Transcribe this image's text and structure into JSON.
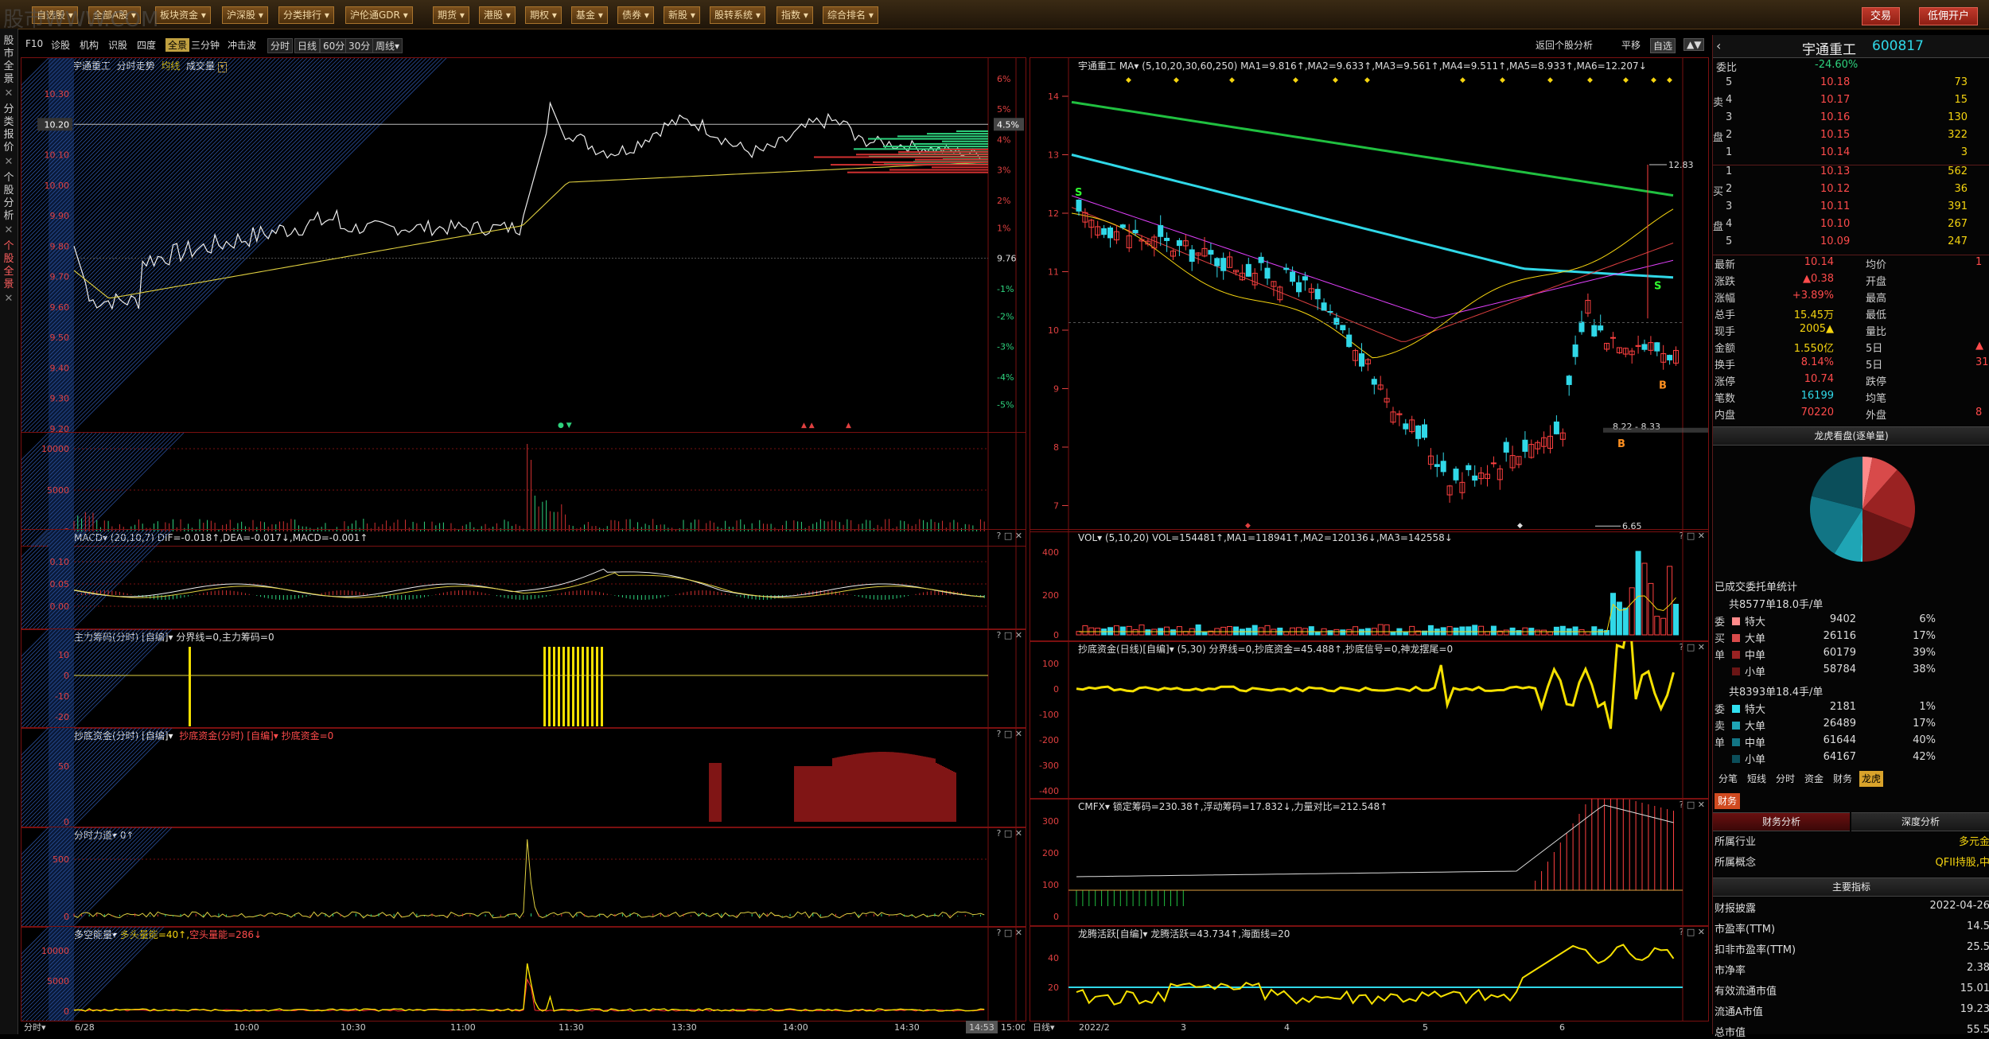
{
  "app": {
    "watermark": "股市WWW.COM"
  },
  "menu": {
    "items": [
      "自选股",
      "全部A股",
      "板块资金",
      "沪深股",
      "分类排行",
      "沪伦通GDR",
      "期货",
      "港股",
      "期权",
      "基金",
      "债券",
      "新股",
      "股转系统",
      "指数",
      "综合排名"
    ],
    "right": [
      "交易",
      "低佣开户"
    ]
  },
  "side_tabs": [
    "股市全景",
    "分类报价",
    "个股分析",
    "个股全景"
  ],
  "toolbar": {
    "items": [
      "F10",
      "诊股",
      "机构",
      "识股",
      "四度",
      "全景",
      "三分钟",
      "冲击波",
      "分时",
      "日线",
      "60分",
      "30分",
      "周线▾"
    ],
    "right": [
      "返回个股分析",
      "平移",
      "自选",
      "▲▼"
    ]
  },
  "stock": {
    "name": "宇通重工",
    "code": "600817"
  },
  "left": {
    "header": [
      "宇通重工",
      "分时走势",
      "均线",
      "成交量"
    ],
    "price_ticks": [
      "10.30",
      "10.20",
      "10.10",
      "10.00",
      "9.90",
      "9.80",
      "9.70",
      "9.60",
      "9.50",
      "9.40",
      "9.30",
      "9.20"
    ],
    "pct_ticks": [
      "6%",
      "5%",
      "4.5%",
      "4%",
      "3%",
      "2%",
      "1%",
      "9.76",
      "-1%",
      "-2%",
      "-3%",
      "-4%",
      "-5%"
    ],
    "vol_ticks": [
      "10000",
      "5000",
      "0"
    ],
    "macd_header": "MACD▾ (20,10,7)  DIF=-0.018↑,DEA=-0.017↓,MACD=-0.001↑",
    "macd_ticks": [
      "0.10",
      "0.05",
      "0.00"
    ],
    "zl_header": "主力筹码(分时) [自编]▾  分界线=0,主力筹码=0",
    "zl_ticks": [
      "10",
      "0",
      "-10",
      "-20"
    ],
    "cd_header": "抄底资金(分时) [自编]▾  抄底资金=0",
    "cd_ticks": [
      "50",
      "0"
    ],
    "fs_header": "分时力道▾  0↑",
    "fs_ticks": [
      "500",
      "0"
    ],
    "dk_header": "多空能量▾  多头量能=40↑,空头量能=286↓",
    "dk_ticks": [
      "10000",
      "5000",
      "0"
    ],
    "x_labels": [
      "6/28",
      "10:00",
      "10:30",
      "11:00",
      "11:30",
      "13:30",
      "14:00",
      "14:30",
      "14:53",
      "15:00"
    ],
    "footer": "分时▾"
  },
  "kline": {
    "header": "宇通重工  MA▾ (5,10,20,30,60,250)  MA1=9.816↑,MA2=9.633↑,MA3=9.561↑,MA4=9.511↑,MA5=8.933↑,MA6=12.207↓",
    "y_ticks": [
      "14",
      "13",
      "12",
      "11",
      "10",
      "9",
      "8",
      "7"
    ],
    "annotations": [
      "12.83",
      "8.22 - 8.33",
      "6.65",
      "S",
      "S",
      "B",
      "B"
    ],
    "vol_header": "VOL▾  (5,10,20)  VOL=154481↑,MA1=118941↑,MA2=120136↓,MA3=142558↓",
    "vol_ticks": [
      "400",
      "200",
      "0"
    ],
    "cd_header": "抄底资金(日线)[自编]▾  (5,30)  分界线=0,抄底资金=45.488↑,抄底信号=0,神龙摆尾=0",
    "cd_ticks": [
      "100",
      "0",
      "-100",
      "-200",
      "-300",
      "-400"
    ],
    "cmf_header": "CMFX▾  锁定筹码=230.38↑,浮动筹码=17.832↓,力量对比=212.548↑",
    "cmf_ticks": [
      "300",
      "200",
      "100",
      "0"
    ],
    "lt_header": "龙腾活跃[自编]▾  龙腾活跃=43.734↑,海面线=20",
    "lt_ticks": [
      "40",
      "20"
    ],
    "x_labels": [
      "2022/2",
      "3",
      "4",
      "5",
      "6"
    ],
    "footer": "日线▾"
  },
  "quote": {
    "weibi_label": "委比",
    "weibi": "-24.60%",
    "asks": [
      {
        "l": "5",
        "p": "10.18",
        "v": "73"
      },
      {
        "l": "4",
        "p": "10.17",
        "v": "15"
      },
      {
        "l": "3",
        "p": "10.16",
        "v": "130"
      },
      {
        "l": "2",
        "p": "10.15",
        "v": "322"
      },
      {
        "l": "1",
        "p": "10.14",
        "v": "3"
      }
    ],
    "bids": [
      {
        "l": "1",
        "p": "10.13",
        "v": "562"
      },
      {
        "l": "2",
        "p": "10.12",
        "v": "36"
      },
      {
        "l": "3",
        "p": "10.11",
        "v": "391"
      },
      {
        "l": "4",
        "p": "10.10",
        "v": "267"
      },
      {
        "l": "5",
        "p": "10.09",
        "v": "247"
      }
    ],
    "side_sell": "卖",
    "side_pan": "盘",
    "side_buy": "买",
    "stats": [
      [
        "最新",
        "10.14",
        "均价",
        "1"
      ],
      [
        "涨跌",
        "▲0.38",
        "开盘",
        ""
      ],
      [
        "涨幅",
        "+3.89%",
        "最高",
        ""
      ],
      [
        "总手",
        "15.45万",
        "最低",
        ""
      ],
      [
        "现手",
        "2005▲",
        "量比",
        ""
      ],
      [
        "金额",
        "1.550亿",
        "5日",
        "▲"
      ],
      [
        "换手",
        "8.14%",
        "5日",
        "31."
      ],
      [
        "涨停",
        "10.74",
        "跌停",
        ""
      ],
      [
        "笔数",
        "16199",
        "均笔",
        ""
      ],
      [
        "内盘",
        "70220",
        "外盘",
        "8"
      ]
    ],
    "pie_title": "龙虎看盘(逐单量)",
    "done_title": "已成交委托单统计",
    "buy_summary": "共8577单18.0手/单",
    "buy_rows": [
      [
        "特大",
        "9402",
        "6%"
      ],
      [
        "大单",
        "26116",
        "17%"
      ],
      [
        "中单",
        "60179",
        "39%"
      ],
      [
        "小单",
        "58784",
        "38%"
      ]
    ],
    "buy_side": [
      "委",
      "买",
      "单"
    ],
    "sell_summary": "共8393单18.4手/单",
    "sell_rows": [
      [
        "特大",
        "2181",
        "1%"
      ],
      [
        "大单",
        "26489",
        "17%"
      ],
      [
        "中单",
        "61644",
        "40%"
      ],
      [
        "小单",
        "64167",
        "42%"
      ]
    ],
    "sell_side": [
      "委",
      "卖",
      "单"
    ],
    "tabs": [
      "分笔",
      "短线",
      "分时",
      "资金",
      "财务",
      "龙虎"
    ],
    "fin_tab": "财务",
    "fin_sub": [
      "财务分析",
      "深度分析"
    ],
    "fin_rows": [
      [
        "所属行业",
        "多元金"
      ],
      [
        "所属概念",
        "QFII持股,中"
      ]
    ],
    "main_title": "主要指标",
    "main_rows": [
      [
        "财报披露",
        "2022-04-26"
      ],
      [
        "市盈率(TTM)",
        "14.5"
      ],
      [
        "扣非市盈率(TTM)",
        "25.5"
      ],
      [
        "市净率",
        "2.38"
      ],
      [
        "有效流通市值",
        "15.01"
      ],
      [
        "流通A市值",
        "19.23"
      ],
      [
        "总市值",
        "55.5"
      ]
    ]
  }
}
